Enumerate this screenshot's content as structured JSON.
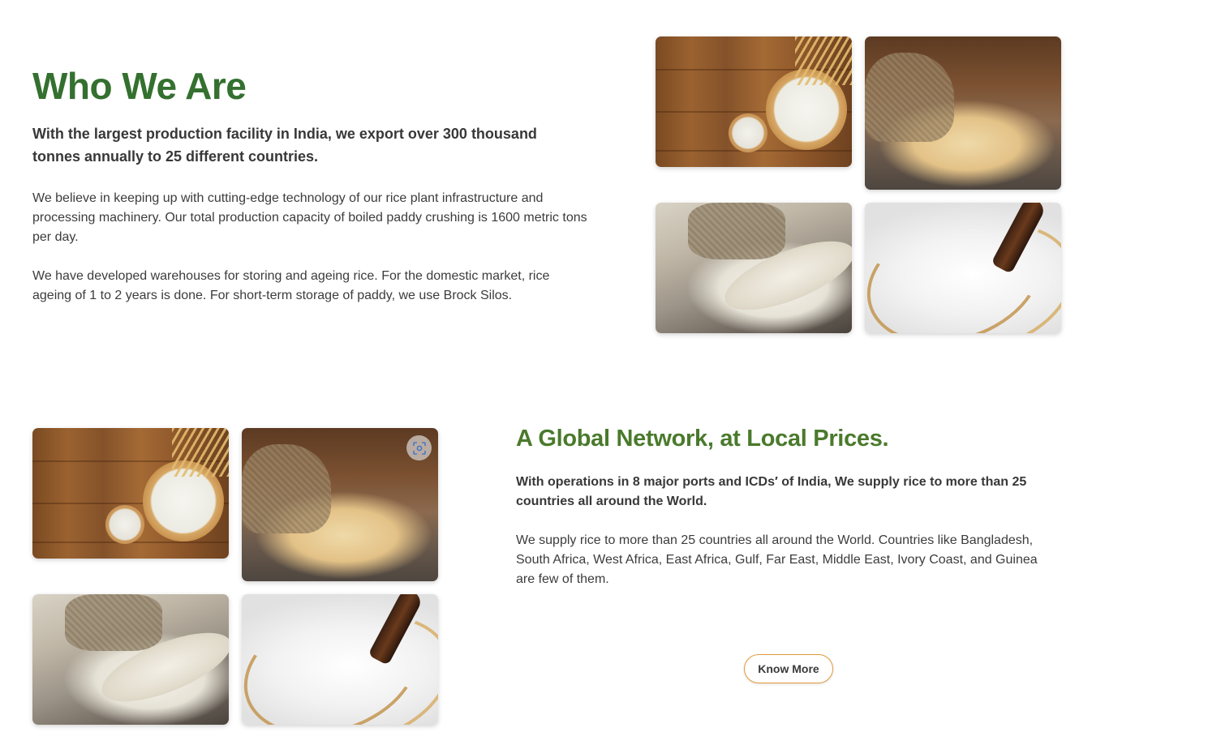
{
  "who_we_are": {
    "title": "Who We Are",
    "lead": "With the largest production facility in India, we export over 300 thousand tonnes annually to 25 different countries.",
    "paragraph1": "We believe in keeping up with cutting-edge technology of our rice plant infrastructure and processing machinery. Our total production capacity of boiled paddy crushing is 1600 metric tons per day.",
    "paragraph2": "We have developed warehouses for storing and ageing rice. For the domestic market, rice ageing of 1 to 2 years is done. For short-term storage of paddy, we use Brock Silos."
  },
  "global_network": {
    "title": "A Global Network, at Local Prices.",
    "lead": "With operations in 8 major ports and ICDs′ of India, We supply rice to more than 25 countries all around the World.",
    "paragraph": "We supply rice to more than 25 countries all around the World. Countries like Bangladesh, South Africa, West Africa, East Africa, Gulf, Far East, Middle East, Ivory Coast, and Guinea are few of them.",
    "button_label": "Know More"
  },
  "colors": {
    "heading_green": "#34702f",
    "heading2_green": "#4a7a2c",
    "button_border": "#e29a3c"
  },
  "icons": {
    "scan_badge": "visual-search-icon"
  }
}
